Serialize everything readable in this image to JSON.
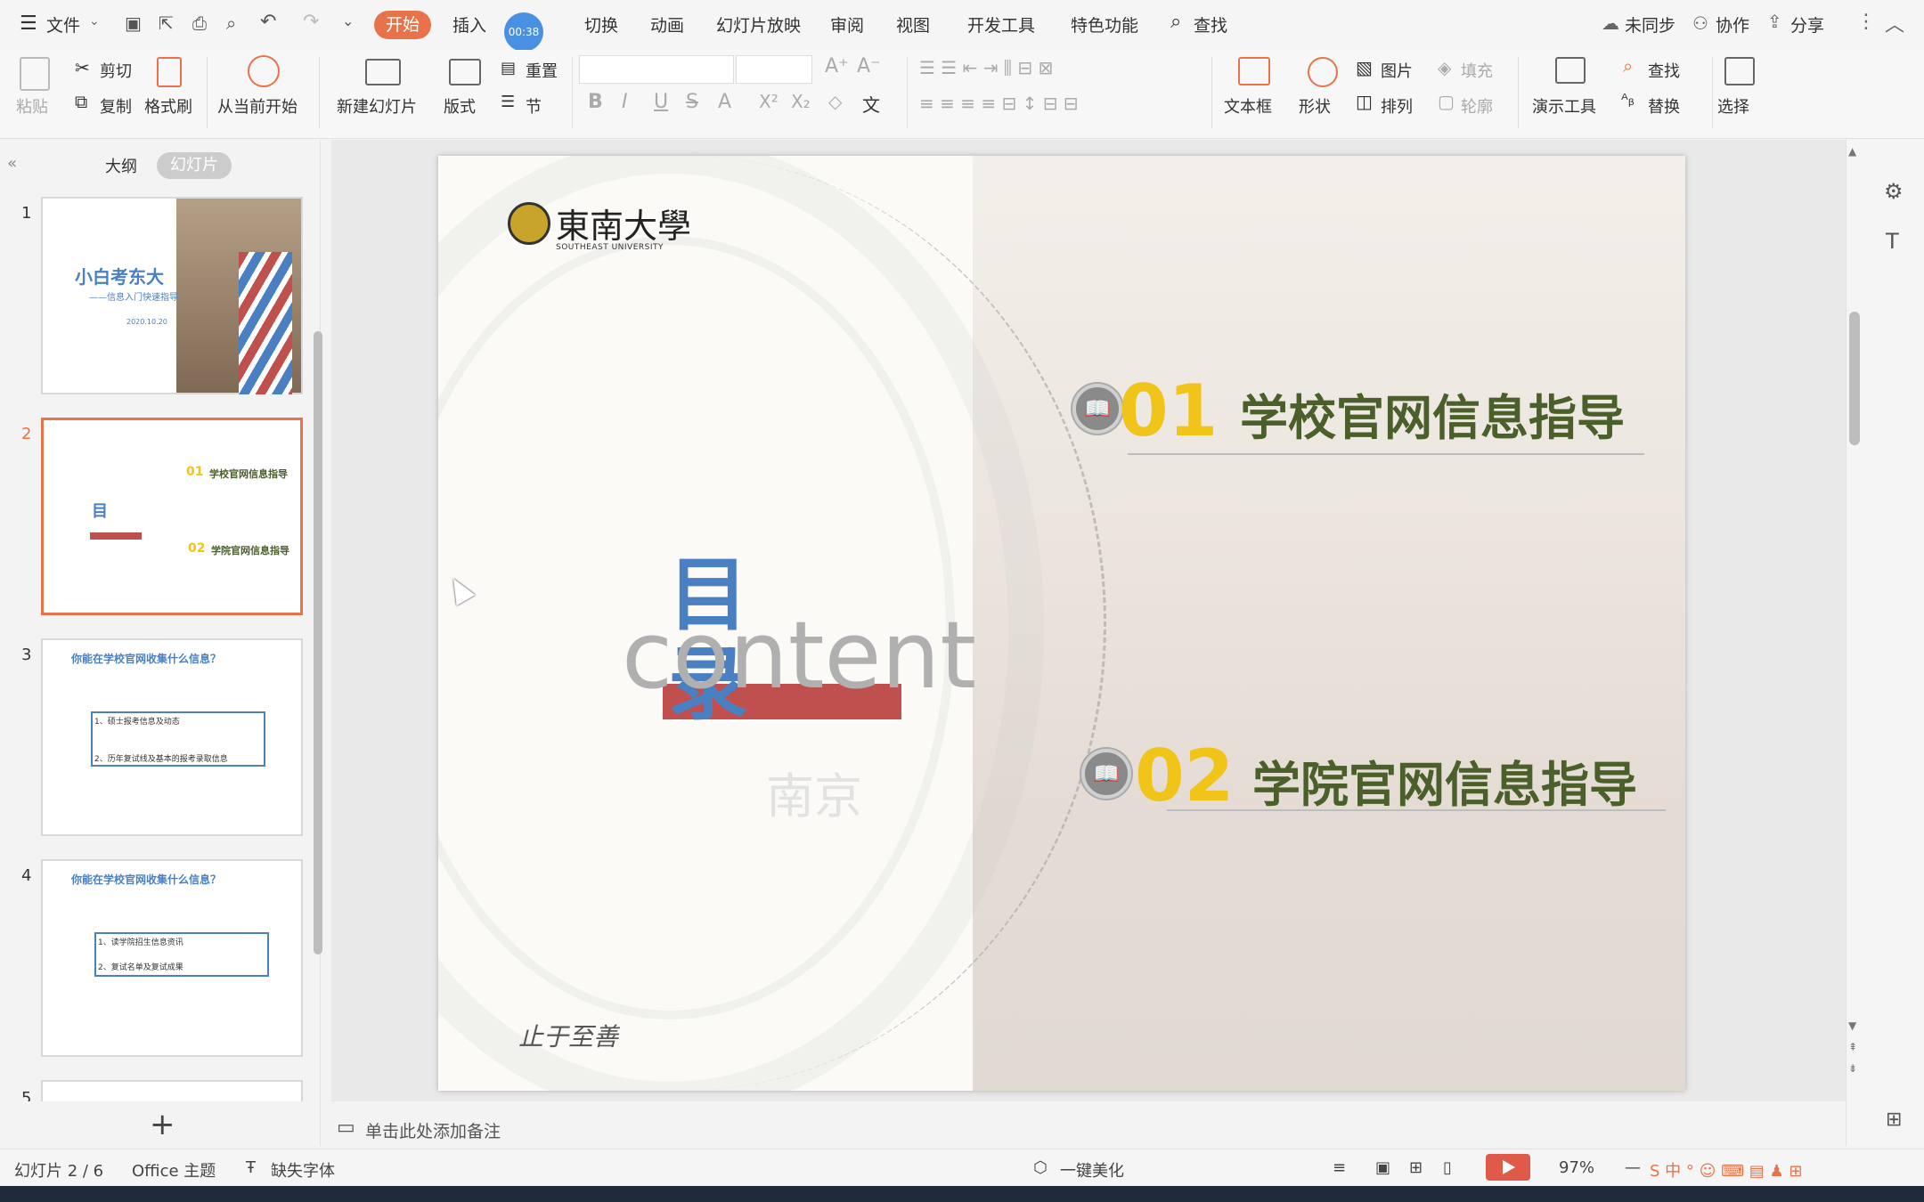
{
  "menubar": {
    "file": "文件",
    "tabs": [
      "开始",
      "插入",
      "切换",
      "动画",
      "幻灯片放映",
      "审阅",
      "视图",
      "开发工具",
      "特色功能"
    ],
    "search": "查找",
    "timer": "00:38",
    "sync": "未同步",
    "collab": "协作",
    "share": "分享"
  },
  "ribbon": {
    "paste": "粘贴",
    "cut": "剪切",
    "copy": "复制",
    "format_painter": "格式刷",
    "from_current": "从当前开始",
    "new_slide": "新建幻灯片",
    "layout": "版式",
    "reset": "重置",
    "section": "节",
    "textbox": "文本框",
    "shape": "形状",
    "picture": "图片",
    "fill": "填充",
    "arrange": "排列",
    "outline": "轮廓",
    "present_tools": "演示工具",
    "find": "查找",
    "replace": "替换",
    "select": "选择"
  },
  "leftpanel": {
    "tab_outline": "大纲",
    "tab_slides": "幻灯片",
    "thumbs": [
      {
        "num": "1",
        "title": "小白考东大",
        "sub": "——信息入门快速指导",
        "date": "2020.10.20"
      },
      {
        "num": "2",
        "item1": "学校官网信息指导",
        "item2": "学院官网信息指导",
        "n1": "01",
        "n2": "02"
      },
      {
        "num": "3",
        "title": "你能在学校官网收集什么信息？",
        "l1": "1、硕士报考信息及动态",
        "l2": "2、历年复试线及基本的报考录取信息"
      },
      {
        "num": "4",
        "title": "你能在学校官网收集什么信息？",
        "l1": "1、读学院招生信息资讯",
        "l2": "2、复试名单及复试成果"
      },
      {
        "num": "5"
      }
    ],
    "add": "+"
  },
  "slide": {
    "logo_cn": "東南大學",
    "logo_en": "SOUTHEAST UNIVERSITY",
    "mulu_1": "目",
    "mulu_2": "录",
    "content_word": "content",
    "nanjing": "南京",
    "motto": "止于至善",
    "items": [
      {
        "num": "01",
        "title": "学校官网信息指导"
      },
      {
        "num": "02",
        "title": "学院官网信息指导"
      }
    ]
  },
  "notes": "单击此处添加备注",
  "status": {
    "slide_count": "幻灯片 2 / 6",
    "theme": "Office 主题",
    "missing_font": "缺失字体",
    "beautify": "一键美化",
    "zoom": "97%"
  },
  "colors": {
    "accent": "#e8734a",
    "mulu_blue": "#4a7fc1",
    "number_yellow": "#f0c419",
    "title_green": "#4b5f2a",
    "red_bar": "#c0504d"
  }
}
